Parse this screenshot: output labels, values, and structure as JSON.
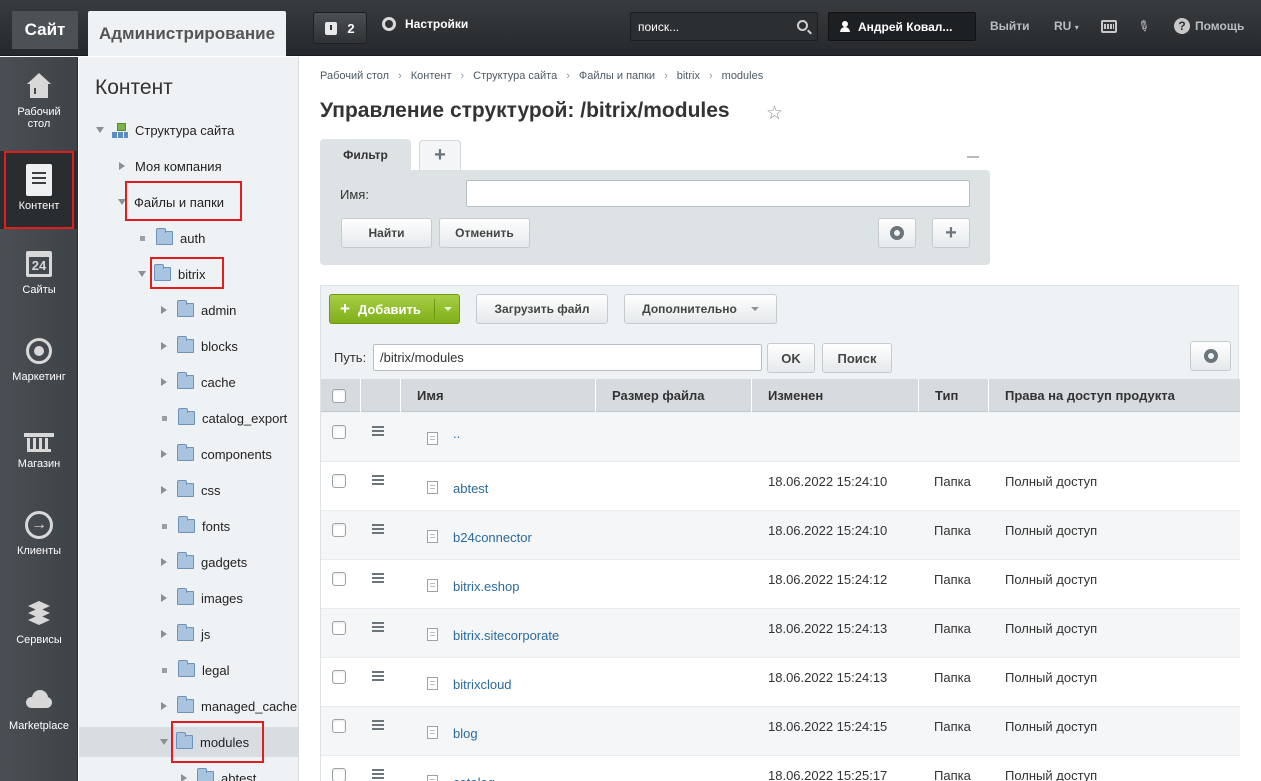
{
  "topbar": {
    "tab_site": "Сайт",
    "tab_admin": "Администрирование",
    "notifications_count": "2",
    "settings_label": "Настройки",
    "search_placeholder": "поиск...",
    "user_name": "Андрей Ковал...",
    "logout": "Выйти",
    "language": "RU",
    "help": "Помощь",
    "help_glyph": "?"
  },
  "leftmenu": {
    "items": [
      {
        "label": "Рабочий стол",
        "icon": "home-icon"
      },
      {
        "label": "Контент",
        "icon": "document-icon",
        "active": true
      },
      {
        "label": "Сайты",
        "icon": "calendar-24-icon",
        "glyph": "24"
      },
      {
        "label": "Маркетинг",
        "icon": "target-icon"
      },
      {
        "label": "Магазин",
        "icon": "basket-icon"
      },
      {
        "label": "Клиенты",
        "icon": "arrow-circle-icon",
        "glyph": "→"
      },
      {
        "label": "Сервисы",
        "icon": "layers-icon"
      },
      {
        "label": "Marketplace",
        "icon": "cloud-icon"
      }
    ]
  },
  "tree": {
    "title": "Контент",
    "items": [
      {
        "label": "Структура сайта"
      },
      {
        "label": "Моя компания"
      },
      {
        "label": "Файлы и папки"
      },
      {
        "label": "auth"
      },
      {
        "label": "bitrix"
      },
      {
        "label": "admin"
      },
      {
        "label": "blocks"
      },
      {
        "label": "cache"
      },
      {
        "label": "catalog_export"
      },
      {
        "label": "components"
      },
      {
        "label": "css"
      },
      {
        "label": "fonts"
      },
      {
        "label": "gadgets"
      },
      {
        "label": "images"
      },
      {
        "label": "js"
      },
      {
        "label": "legal"
      },
      {
        "label": "managed_cache"
      },
      {
        "label": "modules"
      },
      {
        "label": "abtest"
      }
    ]
  },
  "main": {
    "breadcrumb": [
      "Рабочий стол",
      "Контент",
      "Структура сайта",
      "Файлы и папки",
      "bitrix",
      "modules"
    ],
    "breadcrumb_sep": "›",
    "title": "Управление структурой: /bitrix/modules",
    "filter": {
      "tab_label": "Фильтр",
      "name_label": "Имя:",
      "name_value": "",
      "find_button": "Найти",
      "cancel_button": "Отменить"
    },
    "toolbar": {
      "add_button": "Добавить",
      "upload_button": "Загрузить файл",
      "more_button": "Дополнительно",
      "path_label": "Путь:",
      "path_value": "/bitrix/modules",
      "ok_button": "OK",
      "search_button": "Поиск"
    },
    "table": {
      "columns": [
        "Имя",
        "Размер файла",
        "Изменен",
        "Тип",
        "Права на доступ продукта"
      ],
      "rows": [
        {
          "name": "..",
          "date": "",
          "type": "",
          "rights": ""
        },
        {
          "name": "abtest",
          "date": "18.06.2022 15:24:10",
          "type": "Папка",
          "rights": "Полный доступ"
        },
        {
          "name": "b24connector",
          "date": "18.06.2022 15:24:10",
          "type": "Папка",
          "rights": "Полный доступ"
        },
        {
          "name": "bitrix.eshop",
          "date": "18.06.2022 15:24:12",
          "type": "Папка",
          "rights": "Полный доступ"
        },
        {
          "name": "bitrix.sitecorporate",
          "date": "18.06.2022 15:24:13",
          "type": "Папка",
          "rights": "Полный доступ"
        },
        {
          "name": "bitrixcloud",
          "date": "18.06.2022 15:24:13",
          "type": "Папка",
          "rights": "Полный доступ"
        },
        {
          "name": "blog",
          "date": "18.06.2022 15:24:15",
          "type": "Папка",
          "rights": "Полный доступ"
        },
        {
          "name": "catalog",
          "date": "18.06.2022 15:25:17",
          "type": "Папка",
          "rights": "Полный доступ"
        }
      ]
    }
  }
}
